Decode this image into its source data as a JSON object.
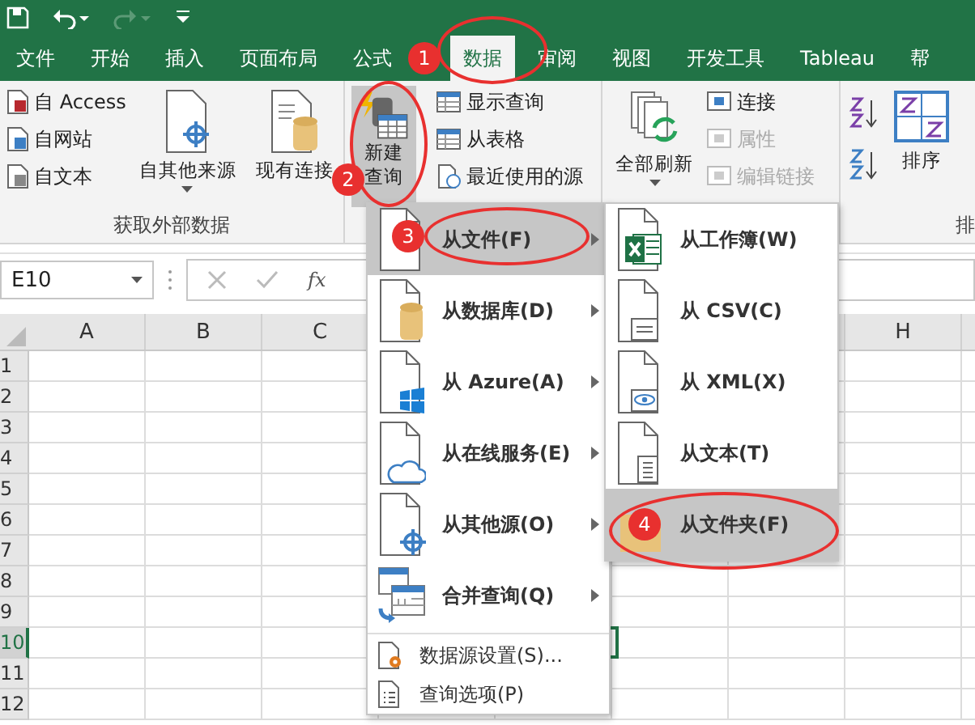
{
  "tabs": [
    {
      "label": "文件",
      "selected": false
    },
    {
      "label": "开始",
      "selected": false
    },
    {
      "label": "插入",
      "selected": false
    },
    {
      "label": "页面布局",
      "selected": false
    },
    {
      "label": "公式",
      "selected": false
    },
    {
      "label": "数据",
      "selected": true
    },
    {
      "label": "审阅",
      "selected": false
    },
    {
      "label": "视图",
      "selected": false
    },
    {
      "label": "开发工具",
      "selected": false
    },
    {
      "label": "Tableau",
      "selected": false
    },
    {
      "label": "帮",
      "selected": false
    }
  ],
  "get_external_data": {
    "small": [
      "自 Access",
      "自网站",
      "自文本"
    ],
    "other_sources": "自其他来源",
    "existing": "现有连接",
    "group_label": "获取外部数据"
  },
  "query": {
    "new_query": [
      "新建",
      "查询"
    ],
    "pressed": true,
    "small": [
      "显示查询",
      "从表格",
      "最近使用的源"
    ]
  },
  "connections": {
    "refresh_all": "全部刷新",
    "small": [
      {
        "label": "连接",
        "disabled": false
      },
      {
        "label": "属性",
        "disabled": true
      },
      {
        "label": "编辑链接",
        "disabled": true
      }
    ]
  },
  "sort": {
    "label": "排序",
    "group_label": "排"
  },
  "formula_bar": {
    "name_box": "E10",
    "fx": "fx"
  },
  "column_headers": [
    "A",
    "B",
    "C",
    "H"
  ],
  "rows": [
    {
      "label": "1",
      "selected": false
    },
    {
      "label": "2",
      "selected": false
    },
    {
      "label": "3",
      "selected": false
    },
    {
      "label": "4",
      "selected": false
    },
    {
      "label": "5",
      "selected": false
    },
    {
      "label": "6",
      "selected": false
    },
    {
      "label": "7",
      "selected": false
    },
    {
      "label": "8",
      "selected": false
    },
    {
      "label": "9",
      "selected": false
    },
    {
      "label": "10",
      "selected": true
    },
    {
      "label": "11",
      "selected": false
    },
    {
      "label": "12",
      "selected": false
    }
  ],
  "menu": {
    "items": [
      {
        "kind": "submenu",
        "label": "从文件(F)",
        "selected": true
      },
      {
        "kind": "submenu",
        "label": "从数据库(D)",
        "selected": false
      },
      {
        "kind": "submenu",
        "label": "从 Azure(A)",
        "selected": false
      },
      {
        "kind": "submenu",
        "label": "从在线服务(E)",
        "selected": false
      },
      {
        "kind": "submenu",
        "label": "从其他源(O)",
        "selected": false
      },
      {
        "kind": "submenu",
        "label": "合并查询(Q)",
        "selected": false
      },
      {
        "kind": "command",
        "label": "数据源设置(S)...",
        "selected": false
      },
      {
        "kind": "command",
        "label": "查询选项(P)",
        "selected": false
      }
    ]
  },
  "submenu": {
    "items": [
      {
        "label": "从工作簿(W)",
        "selected": false
      },
      {
        "label": "从 CSV(C)",
        "selected": false
      },
      {
        "label": "从 XML(X)",
        "selected": false
      },
      {
        "label": "从文本(T)",
        "selected": false
      },
      {
        "label": "从文件夹(F)",
        "selected": true
      }
    ]
  },
  "annotations": [
    "1",
    "2",
    "3",
    "4"
  ]
}
